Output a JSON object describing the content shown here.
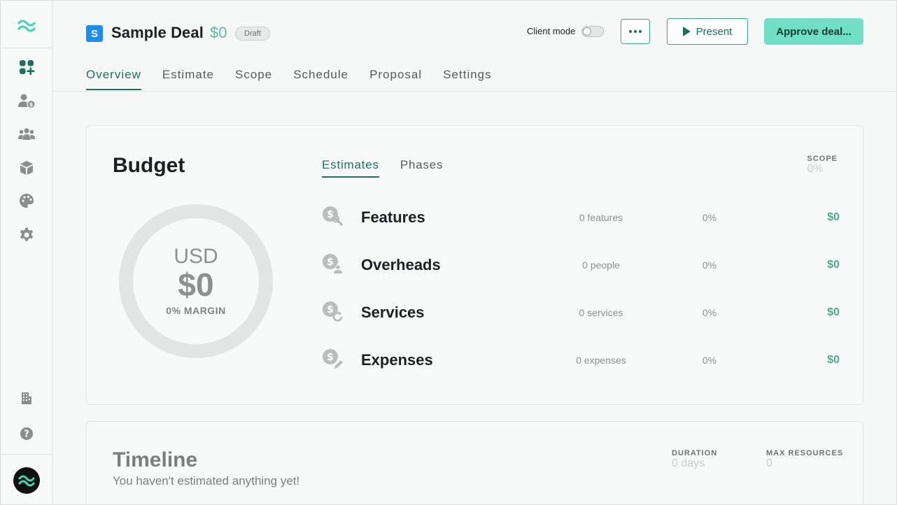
{
  "deal": {
    "badge_letter": "S",
    "name": "Sample Deal",
    "amount": "$0",
    "status": "Draft"
  },
  "header": {
    "client_mode_label": "Client mode",
    "client_mode_on": false,
    "present_label": "Present",
    "approve_label": "Approve deal..."
  },
  "tabs": [
    {
      "label": "Overview",
      "active": true
    },
    {
      "label": "Estimate"
    },
    {
      "label": "Scope"
    },
    {
      "label": "Schedule"
    },
    {
      "label": "Proposal"
    },
    {
      "label": "Settings"
    }
  ],
  "budget": {
    "title": "Budget",
    "currency": "USD",
    "total": "$0",
    "margin": "0% MARGIN",
    "margin_fraction": 0,
    "sub_tabs": [
      {
        "label": "Estimates",
        "active": true
      },
      {
        "label": "Phases"
      }
    ],
    "scope_label": "SCOPE",
    "scope_value": "0%",
    "rows": [
      {
        "icon": "dollar-wrench-icon",
        "name": "Features",
        "count": "0 features",
        "percent": "0%",
        "amount": "$0"
      },
      {
        "icon": "dollar-person-icon",
        "name": "Overheads",
        "count": "0 people",
        "percent": "0%",
        "amount": "$0"
      },
      {
        "icon": "dollar-refresh-icon",
        "name": "Services",
        "count": "0 services",
        "percent": "0%",
        "amount": "$0"
      },
      {
        "icon": "dollar-pencil-icon",
        "name": "Expenses",
        "count": "0 expenses",
        "percent": "0%",
        "amount": "$0"
      }
    ]
  },
  "timeline": {
    "title": "Timeline",
    "subtitle": "You haven't estimated anything yet!",
    "duration_label": "DURATION",
    "duration_value": "0 days",
    "max_resources_label": "MAX RESOURCES",
    "max_resources_value": "0"
  },
  "colors": {
    "accent": "#1f6f5e",
    "accent_light": "#6fe0c6",
    "money": "#4fa88f",
    "badge_blue": "#1e8df0"
  },
  "sidebar": {
    "items": [
      {
        "icon": "dashboard-add-icon"
      },
      {
        "icon": "client-dollar-icon"
      },
      {
        "icon": "team-icon"
      },
      {
        "icon": "package-icon"
      },
      {
        "icon": "palette-icon"
      },
      {
        "icon": "gear-icon"
      }
    ],
    "bottom_items": [
      {
        "icon": "building-icon"
      },
      {
        "icon": "help-icon"
      }
    ]
  }
}
